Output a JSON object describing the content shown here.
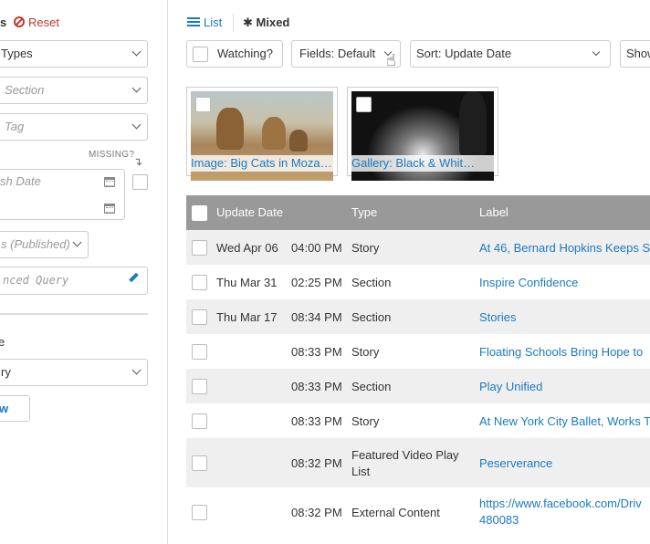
{
  "filters": {
    "header_s": "s",
    "reset_label": "Reset",
    "types_select": "Types",
    "section_placeholder": "Section",
    "tag_placeholder": "Tag",
    "missing_label": "MISSING?",
    "publish_date_placeholder": "sh Date",
    "status_select": "s (Published)",
    "advanced_query_placeholder": "nced Query",
    "sort_label": "e",
    "query_select": "ry",
    "view_button": "w"
  },
  "view_tabs": {
    "list": "List",
    "mixed": "Mixed"
  },
  "toolbar": {
    "watching_label": "Watching?",
    "fields_select": "Fields: Default",
    "sort_select": "Sort: Update Date",
    "show_select": "Show"
  },
  "cards": [
    {
      "caption": "Image: Big Cats in Moza…"
    },
    {
      "caption": "Gallery: Black & Whit…"
    }
  ],
  "table": {
    "columns": {
      "update_date": "Update Date",
      "type": "Type",
      "label": "Label"
    },
    "rows": [
      {
        "date": "Wed Apr 06",
        "time": "04:00 PM",
        "type": "Story",
        "label": "At 46, Bernard Hopkins Keeps S"
      },
      {
        "date": "Thu Mar 31",
        "time": "02:25 PM",
        "type": "Section",
        "label": "Inspire Confidence"
      },
      {
        "date": "Thu Mar 17",
        "time": "08:34 PM",
        "type": "Section",
        "label": "Stories"
      },
      {
        "date": "",
        "time": "08:33 PM",
        "type": "Story",
        "label": "Floating Schools Bring Hope to"
      },
      {
        "date": "",
        "time": "08:33 PM",
        "type": "Section",
        "label": "Play Unified"
      },
      {
        "date": "",
        "time": "08:33 PM",
        "type": "Story",
        "label": "At New York City Ballet, Works T"
      },
      {
        "date": "",
        "time": "08:32 PM",
        "type_line1": "Featured Video Play",
        "type_line2": "List",
        "label": "Peserverance"
      },
      {
        "date": "",
        "time": "08:32 PM",
        "type": "External Content",
        "label_line1": "https://www.facebook.com/Driv",
        "label_line2": "480083"
      }
    ]
  },
  "colors": {
    "link": "#1a7ac2",
    "reset": "#c0392b",
    "header_bg": "#999999",
    "alt_row": "#efefef"
  }
}
